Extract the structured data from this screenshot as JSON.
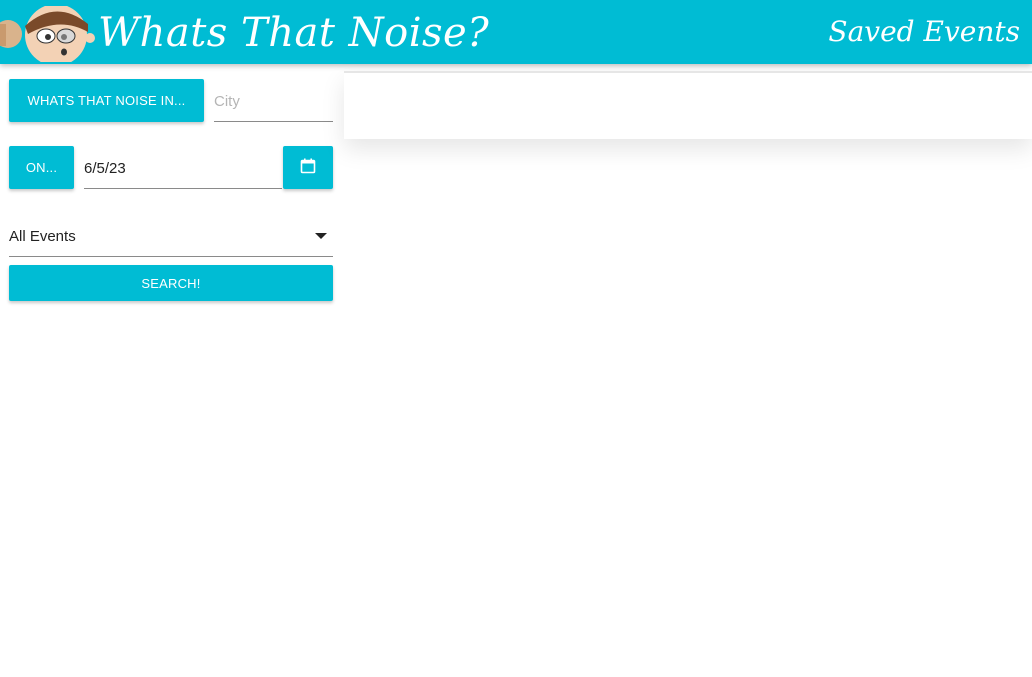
{
  "header": {
    "brand": "Whats That Noise?",
    "nav_saved": "Saved Events"
  },
  "search": {
    "city_button": "WHATS THAT NOISE IN...",
    "city_placeholder": "City",
    "city_value": "",
    "on_button": "ON...",
    "date_value": "6/5/23",
    "calendar_icon": "calendar-icon",
    "event_type": "All Events",
    "search_button": "SEARCH!"
  },
  "colors": {
    "accent": "#00bcd4",
    "text": "#222222"
  }
}
